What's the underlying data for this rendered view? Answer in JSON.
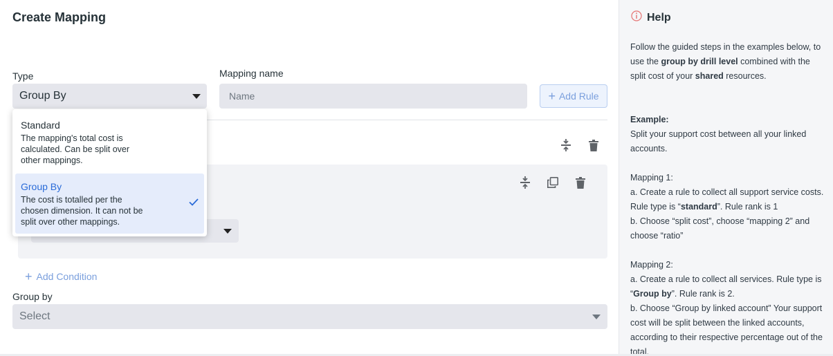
{
  "page": {
    "title": "Create Mapping"
  },
  "type_field": {
    "label": "Type",
    "value": "Group By"
  },
  "name_field": {
    "label": "Mapping name",
    "placeholder": "Name",
    "value": ""
  },
  "add_rule": {
    "label": "Add Rule"
  },
  "add_condition": {
    "label": "Add Condition"
  },
  "group_by": {
    "label": "Group by",
    "placeholder": "Select"
  },
  "type_options": [
    {
      "title": "Standard",
      "description": "The mapping's total cost is calculated. Can be split over other mappings.",
      "selected": false
    },
    {
      "title": "Group By",
      "description": "The cost is totalled per the chosen dimension. It can not be split over other mappings.",
      "selected": true
    }
  ],
  "icons": {
    "split": "split-icon",
    "delete": "trash-icon",
    "copy": "copy-icon",
    "info": "info-icon",
    "check": "check-icon",
    "caret": "chevron-down-icon",
    "plus": "plus-icon"
  },
  "colors": {
    "accent": "#2a6bd8",
    "link": "#7a9fdd",
    "field_bg": "#e5e6ec",
    "help_bg": "#f5f6f8",
    "info": "#e57373"
  },
  "help": {
    "title": "Help",
    "intro_1": "Follow the guided steps in the examples below, to use the ",
    "intro_b1": "group by drill level",
    "intro_2": " combined with the split cost of your ",
    "intro_b2": "shared",
    "intro_3": " resources.",
    "example_label": "Example:",
    "example_text": "Split your support cost between all your linked accounts.",
    "m1_title": "Mapping 1:",
    "m1_a_1": "a. Create a rule to collect all support service costs. Rule type is “",
    "m1_a_b": "standard",
    "m1_a_2": "”. Rule rank is 1",
    "m1_b": "b. Choose “split cost”, choose “mapping 2” and choose “ratio”",
    "m2_title": "Mapping 2:",
    "m2_a_1": "a. Create a rule to collect all services. Rule type is “",
    "m2_a_b": "Group by",
    "m2_a_2": "”. Rule rank is 2.",
    "m2_b": "b. Choose “Group by linked account” Your support cost will be split between the linked accounts, according to their respective percentage out of the total."
  }
}
